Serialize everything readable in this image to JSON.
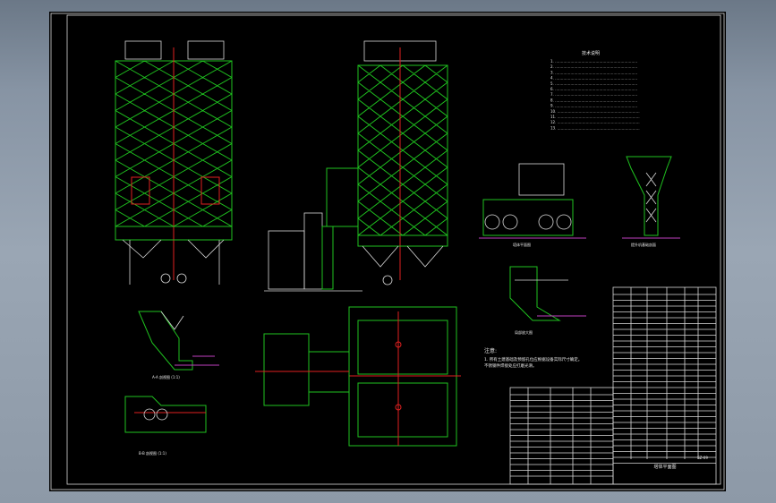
{
  "drawing": {
    "notes_title": "技术说明",
    "notes": [
      "1. ……………………………………………………………",
      "2. ……………………………………………………………",
      "3. ……………………………………………………………",
      "4. ……………………………………………………………",
      "5. ……………………………………………………………",
      "6. ……………………………………………………………",
      "7. ……………………………………………………………",
      "8. ……………………………………………………………",
      "9. ……………………………………………………………",
      "10. ……………………………………………………………",
      "11. ……………………………………………………………",
      "12. ……………………………………………………………",
      "13. ……………………………………………………………"
    ],
    "remarks_title": "注意:",
    "remarks": [
      "1. 所有土建基础及预留孔位应根据设备实际尺寸确定。",
      "   不锈钢件焊接处应打磨光滑。"
    ],
    "section_captions": [
      "A-A 剖视图 (1:1)",
      "B-B 剖视图 (1:1)",
      "局部放大图",
      "塔体平面图",
      "提升机基础剖面"
    ],
    "title_block_title": "塔体平面图",
    "drawing_no": "SZ-09"
  },
  "colors": {
    "background": "#000000",
    "outline": "#1fc21f",
    "centerline": "#e02020",
    "annotation": "#c040c0",
    "text": "#e8e8e8"
  }
}
